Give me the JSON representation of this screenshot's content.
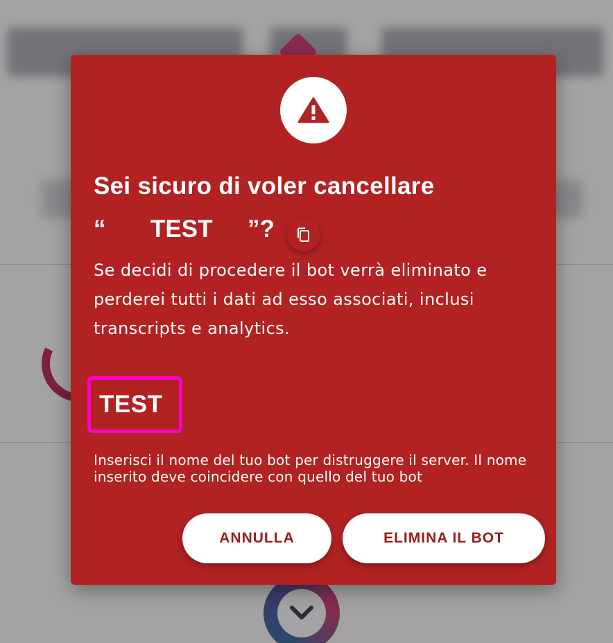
{
  "dialog": {
    "title_line1": "Sei sicuro di voler cancellare",
    "quote_open": "“",
    "bot_name": "TEST",
    "quote_close": "”?",
    "description": "Se decidi di procedere il bot verrà eliminato e perderei tutti i dati ad esso associati, inclusi transcripts e analytics.",
    "input_value": "TEST",
    "help_text": "Inserisci il nome del tuo bot per distruggere il server. Il nome inserito deve coincidere con quello del tuo bot",
    "cancel_label": "ANNULLA",
    "delete_label": "ELIMINA IL BOT",
    "warning_icon": "warning-icon",
    "copy_icon": "copy-icon"
  },
  "colors": {
    "modal_bg": "#b22222",
    "overlay": "#a3a3a3",
    "focus_border": "#ff00cc",
    "button_text": "#9b1b1b"
  }
}
